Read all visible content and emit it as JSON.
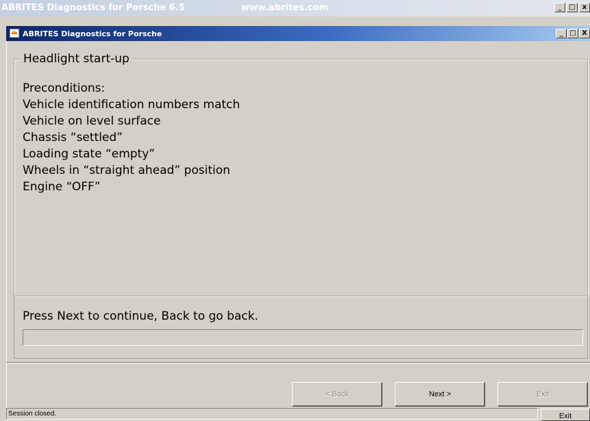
{
  "outer_window": {
    "title": "ABRITES Diagnostics for Porsche 6.5",
    "url": "www.abrites.com",
    "minimize": "_",
    "maximize": "□",
    "close": "x"
  },
  "inner_window": {
    "title": "ABRITES Diagnostics for Porsche",
    "minimize": "_",
    "maximize": "□",
    "close": "X"
  },
  "group": {
    "title": "Headlight start-up",
    "lines": [
      "Preconditions:",
      "Vehicle identification numbers match",
      "Vehicle on level surface",
      "Chassis “settled”",
      "Loading state “empty”",
      "Wheels in “straight ahead” position",
      "Engine “OFF”"
    ]
  },
  "message": "Press Next to continue, Back to go back.",
  "buttons": {
    "back": "< Back",
    "next": "Next >",
    "exit": "Exit"
  },
  "status": {
    "text": "Session closed.",
    "exit": "Exit"
  },
  "icons": {
    "app": "abrites-app-icon"
  }
}
